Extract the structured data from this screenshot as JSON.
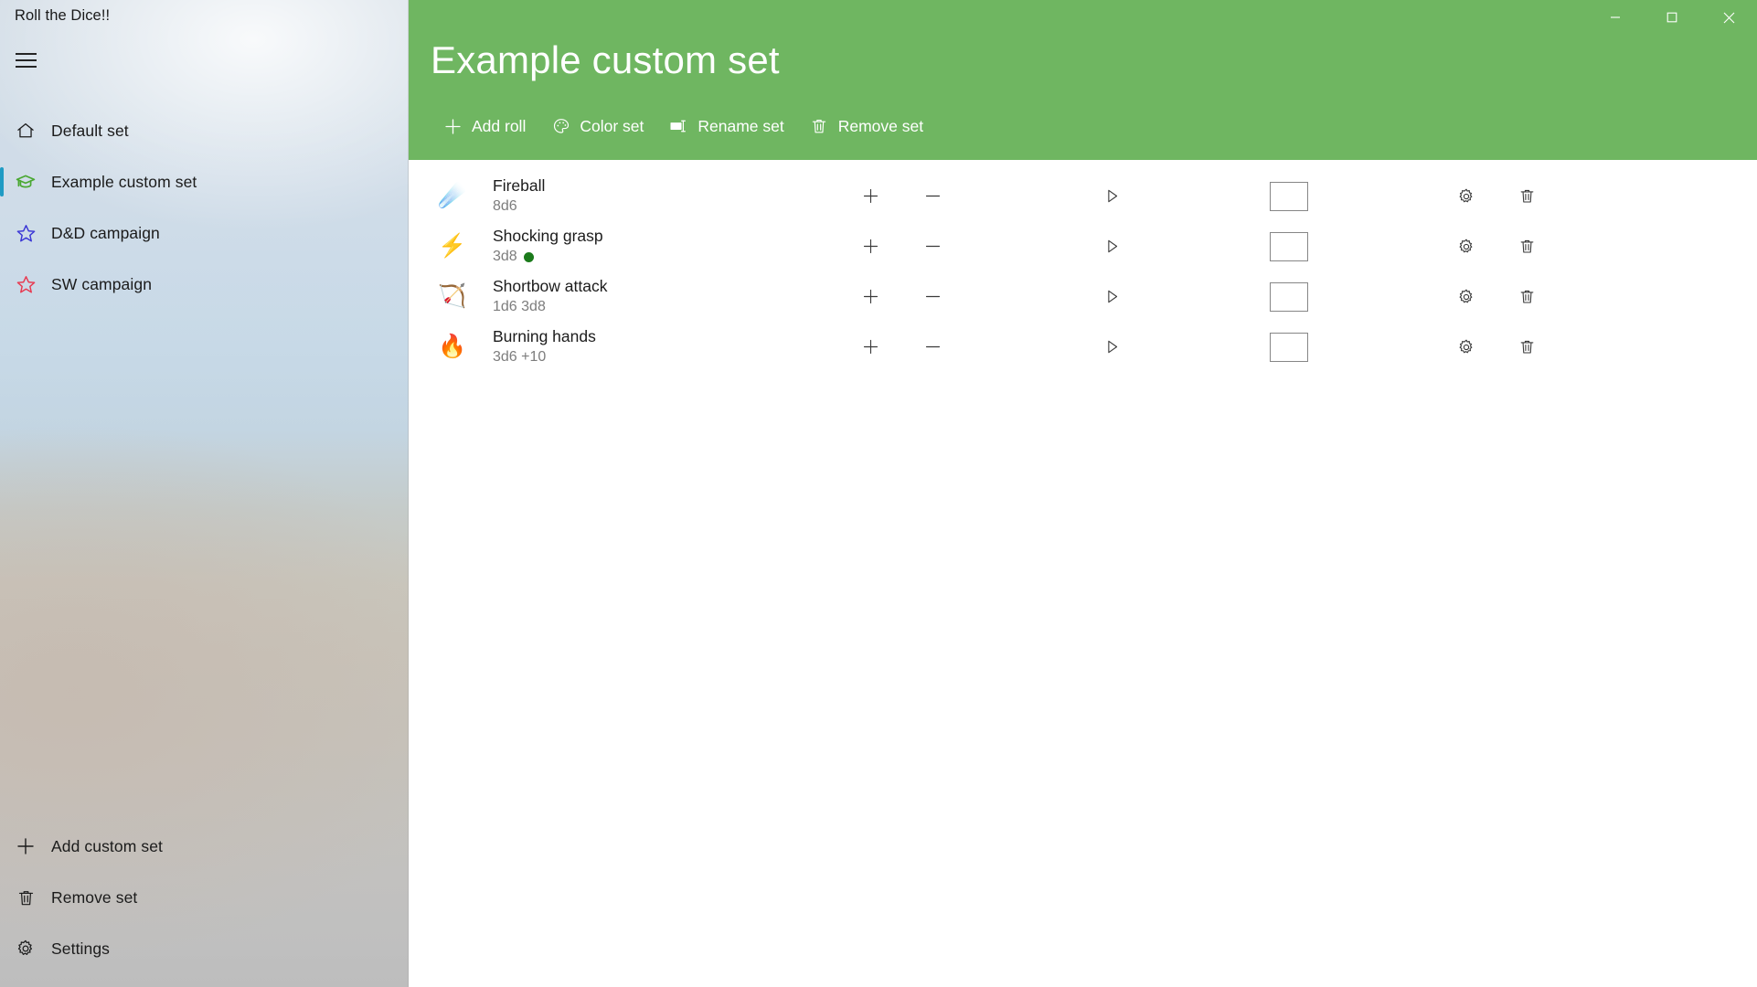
{
  "window": {
    "app_title": "Roll the Dice!!",
    "controls": [
      {
        "name": "minimize",
        "glyph": "minimize-icon"
      },
      {
        "name": "maximize",
        "glyph": "maximize-icon"
      },
      {
        "name": "close",
        "glyph": "close-icon"
      }
    ]
  },
  "colors": {
    "header_green": "#6fb661",
    "selection_accent": "#1f9bc4",
    "roll_dot_green": "#1b7a1b",
    "primary_text": "#1c1c1c",
    "secondary_text": "#7d7d7d"
  },
  "sidebar": {
    "menu_icon": "hamburger-icon",
    "items": [
      {
        "label": "Default set",
        "icon": "home-icon",
        "emoji": "⌂",
        "selected": false
      },
      {
        "label": "Example custom set",
        "icon": "graduation-cap-icon",
        "emoji": "🎓",
        "selected": true
      },
      {
        "label": "D&D campaign",
        "icon": "star-icon",
        "emoji": "☆",
        "selected": false
      },
      {
        "label": "SW campaign",
        "icon": "star-icon",
        "emoji": "☆",
        "selected": false
      }
    ],
    "bottom_items": [
      {
        "label": "Add custom set",
        "icon": "plus-icon"
      },
      {
        "label": "Remove set",
        "icon": "trash-icon"
      },
      {
        "label": "Settings",
        "icon": "gear-icon"
      }
    ]
  },
  "header": {
    "title": "Example custom set",
    "commands": [
      {
        "label": "Add roll",
        "icon": "plus-icon"
      },
      {
        "label": "Color set",
        "icon": "palette-icon"
      },
      {
        "label": "Rename set",
        "icon": "rename-icon"
      },
      {
        "label": "Remove set",
        "icon": "trash-icon"
      }
    ]
  },
  "rolls": {
    "items": [
      {
        "emoji": "☄️",
        "icon": "comet-icon",
        "name": "Fireball",
        "dice": "8d6",
        "has_dot": false,
        "result": ""
      },
      {
        "emoji": "⚡",
        "icon": "lightning-icon",
        "name": "Shocking grasp",
        "dice": "3d8",
        "has_dot": true,
        "result": ""
      },
      {
        "emoji": "🏹",
        "icon": "bow-and-arrow-icon",
        "name": "Shortbow attack",
        "dice": "1d6 3d8",
        "has_dot": false,
        "result": ""
      },
      {
        "emoji": "🔥",
        "icon": "fire-icon",
        "name": "Burning hands",
        "dice": "3d6 +10",
        "has_dot": false,
        "result": ""
      }
    ],
    "row_actions": {
      "increase": "plus-icon",
      "decrease": "minus-icon",
      "roll": "play-icon",
      "result": "result-box",
      "settings": "gear-icon",
      "remove": "trash-icon"
    }
  }
}
